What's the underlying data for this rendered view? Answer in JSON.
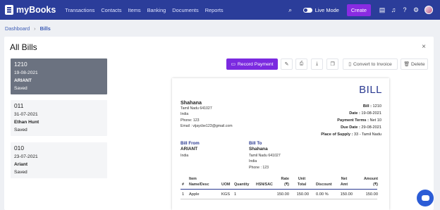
{
  "app": {
    "logo": "myBooks"
  },
  "nav": [
    "Transactions",
    "Contacts",
    "Items",
    "Banking",
    "Documents",
    "Reports"
  ],
  "topbar": {
    "live_mode": "Live Mode",
    "create": "Create"
  },
  "breadcrumb": {
    "root": "Dashboard",
    "current": "Bills"
  },
  "page": {
    "title": "All Bills",
    "close": "×"
  },
  "bills": [
    {
      "number": "1210",
      "date": "19-08-2021",
      "name": "ARIANT",
      "status": "Saved"
    },
    {
      "number": "011",
      "date": "31-07-2021",
      "name": "Ethan Hunt",
      "status": "Saved"
    },
    {
      "number": "010",
      "date": "23-07-2021",
      "name": "Ariant",
      "status": "Saved"
    }
  ],
  "actions": {
    "record_payment": "Record Payment",
    "convert": "Convert to Invoice",
    "delete": "Delete"
  },
  "doc": {
    "heading": "BILL",
    "from_name": "Shahana",
    "from_lines": [
      "Tamil Nadu 641027",
      "India",
      "Phone: 123",
      "Email : vijaycbe123@gmail.com"
    ],
    "meta": [
      {
        "label": "Bill :",
        "value": "1210"
      },
      {
        "label": "Date :",
        "value": "19-08-2021"
      },
      {
        "label": "Payment Terms :",
        "value": "Net 10"
      },
      {
        "label": "Due Date :",
        "value": "29-08-2021"
      },
      {
        "label": "Place of Supply :",
        "value": "33 - Tamil Nadu"
      }
    ],
    "bill_from_label": "Bill From",
    "bill_from_name": "ARIANT",
    "bill_from_lines": [
      "India"
    ],
    "bill_to_label": "Bill To",
    "bill_to_name": "Shahana",
    "bill_to_lines": [
      "Tamil Nadu 641027",
      "India",
      "Phone : 123"
    ],
    "table_headers": [
      "#",
      "Item Name/Desc",
      "UOM",
      "Quantity",
      "HSN/SAC",
      "Rate (₹)",
      "Unit Total",
      "Discount",
      "Net Amt",
      "Amount (₹)"
    ],
    "rows": [
      [
        "1",
        "Apple",
        "KGS",
        "1",
        "",
        "150.00",
        "150.00",
        "0.00 %",
        "150.00",
        "150.00"
      ]
    ]
  }
}
